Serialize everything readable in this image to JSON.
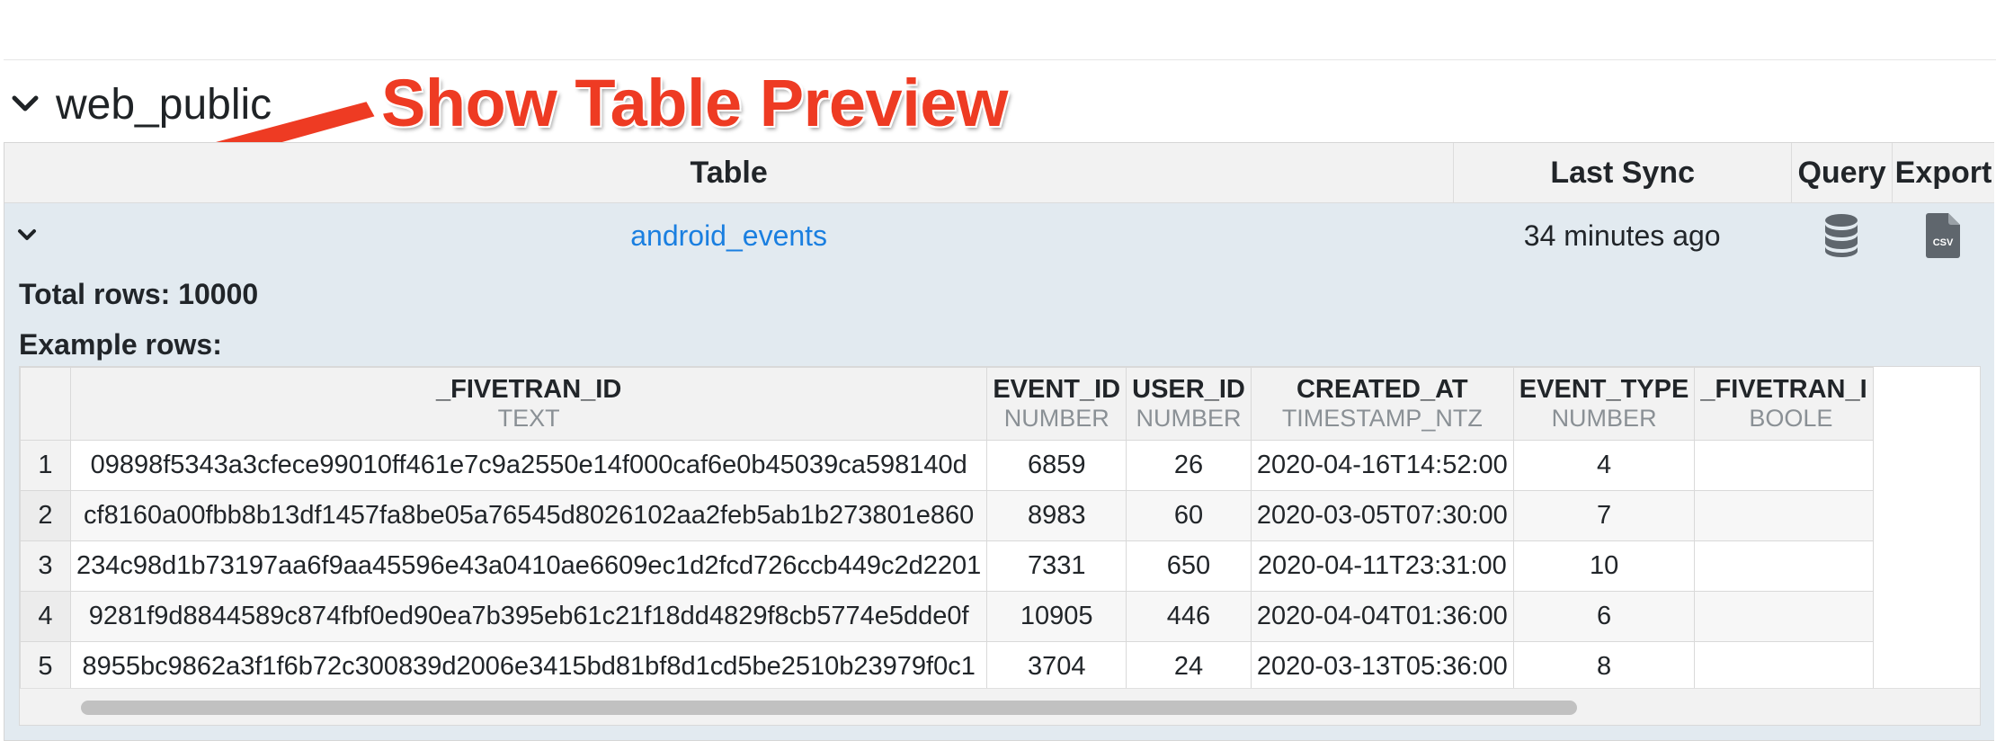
{
  "schema": {
    "title": "web_public"
  },
  "annotation": {
    "text": "Show Table Preview"
  },
  "outer_table": {
    "headers": {
      "table": "Table",
      "last_sync": "Last Sync",
      "query": "Query",
      "export": "Export"
    },
    "row": {
      "name": "android_events",
      "last_sync": "34 minutes ago",
      "query_icon": "database-icon",
      "export_icon": "csv-file-icon"
    }
  },
  "preview": {
    "total_rows_label": "Total rows: 10000",
    "example_rows_label": "Example rows:",
    "columns": [
      {
        "name": "_FIVETRAN_ID",
        "type": "TEXT"
      },
      {
        "name": "EVENT_ID",
        "type": "NUMBER"
      },
      {
        "name": "USER_ID",
        "type": "NUMBER"
      },
      {
        "name": "CREATED_AT",
        "type": "TIMESTAMP_NTZ"
      },
      {
        "name": "EVENT_TYPE",
        "type": "NUMBER"
      },
      {
        "name": "_FIVETRAN_I",
        "type": "BOOLE"
      }
    ],
    "rows": [
      {
        "index": "1",
        "cells": [
          "09898f5343a3cfece99010ff461e7c9a2550e14f000caf6e0b45039ca598140d",
          "6859",
          "26",
          "2020-04-16T14:52:00",
          "4",
          ""
        ]
      },
      {
        "index": "2",
        "cells": [
          "cf8160a00fbb8b13df1457fa8be05a76545d8026102aa2feb5ab1b273801e860",
          "8983",
          "60",
          "2020-03-05T07:30:00",
          "7",
          ""
        ]
      },
      {
        "index": "3",
        "cells": [
          "234c98d1b73197aa6f9aa45596e43a0410ae6609ec1d2fcd726ccb449c2d2201",
          "7331",
          "650",
          "2020-04-11T23:31:00",
          "10",
          ""
        ]
      },
      {
        "index": "4",
        "cells": [
          "9281f9d8844589c874fbf0ed90ea7b395eb61c21f18dd4829f8cb5774e5dde0f",
          "10905",
          "446",
          "2020-04-04T01:36:00",
          "6",
          ""
        ]
      },
      {
        "index": "5",
        "cells": [
          "8955bc9862a3f1f6b72c300839d2006e3415bd81bf8d1cd5be2510b23979f0c1",
          "3704",
          "24",
          "2020-03-13T05:36:00",
          "8",
          ""
        ]
      }
    ]
  },
  "colors": {
    "link": "#1a7fe0",
    "annotation": "#ee3b23",
    "row_bg": "#e2eaf0"
  }
}
